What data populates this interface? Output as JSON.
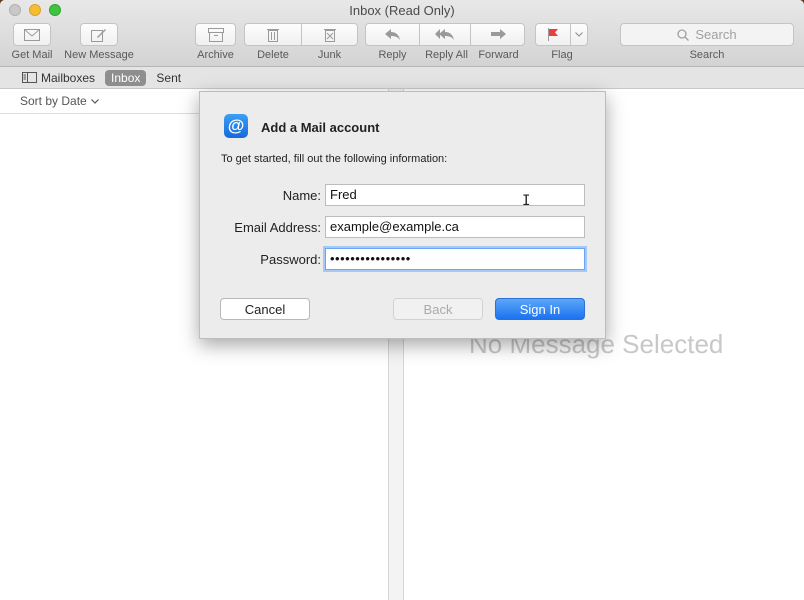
{
  "window": {
    "title": "Inbox (Read Only)"
  },
  "toolbar": {
    "get_mail": "Get Mail",
    "new_message": "New Message",
    "archive": "Archive",
    "delete": "Delete",
    "junk": "Junk",
    "reply": "Reply",
    "reply_all": "Reply All",
    "forward": "Forward",
    "flag": "Flag",
    "search_placeholder": "Search",
    "search_label": "Search"
  },
  "favorites": {
    "mailboxes": "Mailboxes",
    "inbox": "Inbox",
    "sent": "Sent"
  },
  "list": {
    "sort_label": "Sort by Date"
  },
  "viewer": {
    "empty_text": "No Message Selected"
  },
  "dialog": {
    "title": "Add a Mail account",
    "description": "To get started, fill out the following information:",
    "name_label": "Name:",
    "name_value": "Fred",
    "email_label": "Email Address:",
    "email_value": "example@example.ca",
    "password_label": "Password:",
    "password_value": "••••••••••••••••",
    "cancel_label": "Cancel",
    "back_label": "Back",
    "signin_label": "Sign In"
  },
  "colors": {
    "accent": "#1c72f0",
    "flag": "#e8413c"
  }
}
